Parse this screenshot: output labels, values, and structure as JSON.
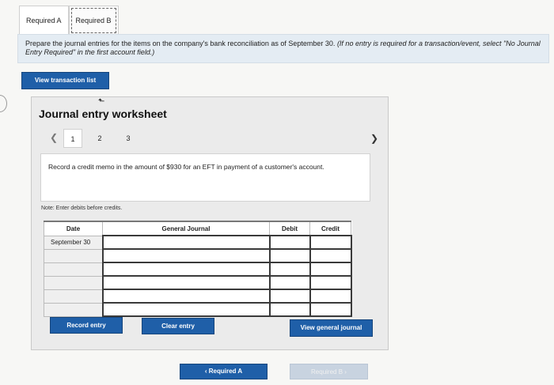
{
  "tabs": [
    {
      "label": "Required A",
      "active": true
    },
    {
      "label": "Required B",
      "active": false
    }
  ],
  "instructions": {
    "main": "Prepare the journal entries for the items on the company's bank reconciliation as of September 30. ",
    "note": "(If no entry is required for a transaction/event, select \"No Journal Entry Required\" in the first account field.)"
  },
  "view_transaction_label": "View transaction list",
  "worksheet": {
    "title": "Journal entry worksheet",
    "pages": [
      "1",
      "2",
      "3"
    ],
    "current_page": "1",
    "prev_icon": "chevron-left",
    "next_icon": "chevron-right",
    "memo": "Record a credit memo in the amount of $930 for an EFT in payment of a customer's account.",
    "note": "Note: Enter debits before credits.",
    "table": {
      "headers": [
        "Date",
        "General Journal",
        "Debit",
        "Credit"
      ],
      "rows": [
        [
          "September 30",
          "",
          "",
          ""
        ],
        [
          "",
          "",
          "",
          ""
        ],
        [
          "",
          "",
          "",
          ""
        ],
        [
          "",
          "",
          "",
          ""
        ],
        [
          "",
          "",
          "",
          ""
        ],
        [
          "",
          "",
          "",
          ""
        ]
      ]
    },
    "buttons": {
      "record": "Record entry",
      "clear": "Clear entry",
      "view_general": "View general journal"
    }
  },
  "footer": {
    "prev_label": "Required A",
    "next_label": "Required B"
  },
  "colors": {
    "accent": "#1f5fa8",
    "instruction_bg": "#e4ecf3"
  }
}
